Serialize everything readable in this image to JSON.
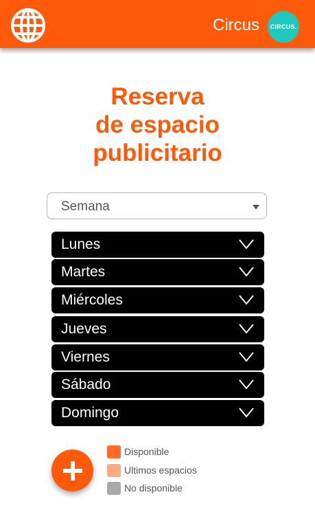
{
  "header": {
    "brand_name": "Circus",
    "avatar_text": "CIRCUS.",
    "menu_icon": "globe-icon",
    "colors": {
      "bar": "#ff5a0a",
      "avatar": "#1ec8bd"
    }
  },
  "title": {
    "line1": "Reserva",
    "line2": "de espacio",
    "line3": "publicitario",
    "color": "#ff5a0a"
  },
  "period_select": {
    "selected": "Semana",
    "icon": "caret-down-icon"
  },
  "days": [
    {
      "label": "Lunes",
      "icon": "chevron-down-icon"
    },
    {
      "label": "Martes",
      "icon": "chevron-down-icon"
    },
    {
      "label": "Miércoles",
      "icon": "chevron-down-icon"
    },
    {
      "label": "Jueves",
      "icon": "chevron-down-icon"
    },
    {
      "label": "Viernes",
      "icon": "chevron-down-icon"
    },
    {
      "label": "Sábado",
      "icon": "chevron-down-icon"
    },
    {
      "label": "Domingo",
      "icon": "chevron-down-icon"
    }
  ],
  "fab": {
    "icon": "plus-icon",
    "color": "#ff5a0a"
  },
  "legend": [
    {
      "label": "Disponible",
      "color": "#ff6a2a"
    },
    {
      "label": "Ultimos espacios",
      "color": "#ffaa80"
    },
    {
      "label": "No disponible",
      "color": "#a9a9a9"
    }
  ]
}
